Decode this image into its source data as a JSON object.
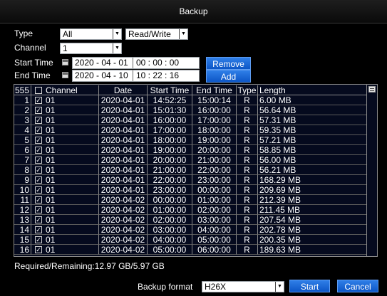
{
  "window": {
    "title": "Backup"
  },
  "form": {
    "type_label": "Type",
    "type_value": "All",
    "mode_value": "Read/Write",
    "channel_label": "Channel",
    "channel_value": "1",
    "start_label": "Start Time",
    "start_date": "2020 - 04 - 01",
    "start_time": "00 : 00 : 00",
    "end_label": "End Time",
    "end_date": "2020 - 04 - 10",
    "end_time": "10 : 22 : 16",
    "remove_label": "Remove",
    "add_label": "Add"
  },
  "table": {
    "count": "555",
    "headers": {
      "channel": "Channel",
      "date": "Date",
      "start": "Start Time",
      "end": "End Time",
      "type": "Type",
      "length": "Length"
    },
    "rows": [
      {
        "n": "1",
        "ch": "01",
        "date": "2020-04-01",
        "start": "14:52:25",
        "end": "15:00:14",
        "type": "R",
        "len": "6.00 MB"
      },
      {
        "n": "2",
        "ch": "01",
        "date": "2020-04-01",
        "start": "15:01:30",
        "end": "16:00:00",
        "type": "R",
        "len": "56.64 MB"
      },
      {
        "n": "3",
        "ch": "01",
        "date": "2020-04-01",
        "start": "16:00:00",
        "end": "17:00:00",
        "type": "R",
        "len": "57.31 MB"
      },
      {
        "n": "4",
        "ch": "01",
        "date": "2020-04-01",
        "start": "17:00:00",
        "end": "18:00:00",
        "type": "R",
        "len": "59.35 MB"
      },
      {
        "n": "5",
        "ch": "01",
        "date": "2020-04-01",
        "start": "18:00:00",
        "end": "19:00:00",
        "type": "R",
        "len": "57.21 MB"
      },
      {
        "n": "6",
        "ch": "01",
        "date": "2020-04-01",
        "start": "19:00:00",
        "end": "20:00:00",
        "type": "R",
        "len": "58.85 MB"
      },
      {
        "n": "7",
        "ch": "01",
        "date": "2020-04-01",
        "start": "20:00:00",
        "end": "21:00:00",
        "type": "R",
        "len": "56.00 MB"
      },
      {
        "n": "8",
        "ch": "01",
        "date": "2020-04-01",
        "start": "21:00:00",
        "end": "22:00:00",
        "type": "R",
        "len": "56.21 MB"
      },
      {
        "n": "9",
        "ch": "01",
        "date": "2020-04-01",
        "start": "22:00:00",
        "end": "23:00:00",
        "type": "R",
        "len": "168.29 MB"
      },
      {
        "n": "10",
        "ch": "01",
        "date": "2020-04-01",
        "start": "23:00:00",
        "end": "00:00:00",
        "type": "R",
        "len": "209.69 MB"
      },
      {
        "n": "11",
        "ch": "01",
        "date": "2020-04-02",
        "start": "00:00:00",
        "end": "01:00:00",
        "type": "R",
        "len": "212.39 MB"
      },
      {
        "n": "12",
        "ch": "01",
        "date": "2020-04-02",
        "start": "01:00:00",
        "end": "02:00:00",
        "type": "R",
        "len": "211.45 MB"
      },
      {
        "n": "13",
        "ch": "01",
        "date": "2020-04-02",
        "start": "02:00:00",
        "end": "03:00:00",
        "type": "R",
        "len": "207.54 MB"
      },
      {
        "n": "14",
        "ch": "01",
        "date": "2020-04-02",
        "start": "03:00:00",
        "end": "04:00:00",
        "type": "R",
        "len": "202.78 MB"
      },
      {
        "n": "15",
        "ch": "01",
        "date": "2020-04-02",
        "start": "04:00:00",
        "end": "05:00:00",
        "type": "R",
        "len": "200.35 MB"
      },
      {
        "n": "16",
        "ch": "01",
        "date": "2020-04-02",
        "start": "05:00:00",
        "end": "06:00:00",
        "type": "R",
        "len": "189.63 MB"
      }
    ]
  },
  "footer": {
    "capacity": "Required/Remaining:12.97 GB/5.97 GB",
    "format_label": "Backup format",
    "format_value": "H26X",
    "start_label": "Start",
    "cancel_label": "Cancel"
  }
}
